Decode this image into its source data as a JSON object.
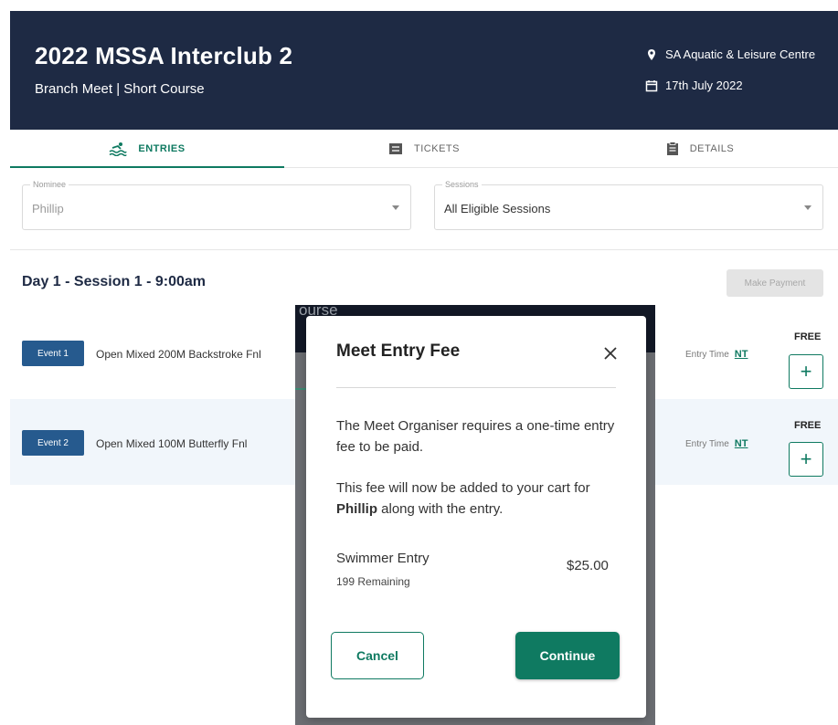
{
  "header": {
    "title": "2022 MSSA Interclub 2",
    "subtitle": "Branch Meet | Short Course",
    "location": "SA Aquatic & Leisure Centre",
    "date": "17th July 2022",
    "location_icon": "map-pin-icon",
    "date_icon": "calendar-icon",
    "background_color": "#1e2a44"
  },
  "tabs": [
    {
      "label": "ENTRIES",
      "icon": "swimmer-icon",
      "active": true
    },
    {
      "label": "TICKETS",
      "icon": "ticket-icon",
      "active": false
    },
    {
      "label": "DETAILS",
      "icon": "clipboard-icon",
      "active": false
    }
  ],
  "filters": {
    "nominee": {
      "label": "Nominee",
      "value": "Phillip"
    },
    "sessions": {
      "label": "Sessions",
      "value": "All Eligible Sessions"
    }
  },
  "session": {
    "title": "Day 1 - Session 1 - 9:00am",
    "make_payment_label": "Make Payment"
  },
  "events": [
    {
      "badge": "Event 1",
      "name": "Open Mixed 200M Backstroke Fnl",
      "entry_time_label": "Entry Time",
      "entry_time": "NT",
      "price": "FREE"
    },
    {
      "badge": "Event 2",
      "name": "Open Mixed 100M Butterfly Fnl",
      "entry_time_label": "Entry Time",
      "entry_time": "NT",
      "price": "FREE"
    }
  ],
  "background_ghost": {
    "partial_text": "ourse"
  },
  "modal": {
    "title": "Meet Entry Fee",
    "paragraph1": "The Meet Organiser requires a one-time entry fee to be paid.",
    "paragraph2_prefix": "This fee will now be added to your cart for ",
    "paragraph2_name": "Phillip",
    "paragraph2_suffix": " along with the entry.",
    "fee_name": "Swimmer Entry",
    "fee_remaining": "199 Remaining",
    "fee_price": "$25.00",
    "cancel_label": "Cancel",
    "continue_label": "Continue"
  },
  "colors": {
    "accent": "#0f7a61",
    "badge": "#265a8e"
  }
}
